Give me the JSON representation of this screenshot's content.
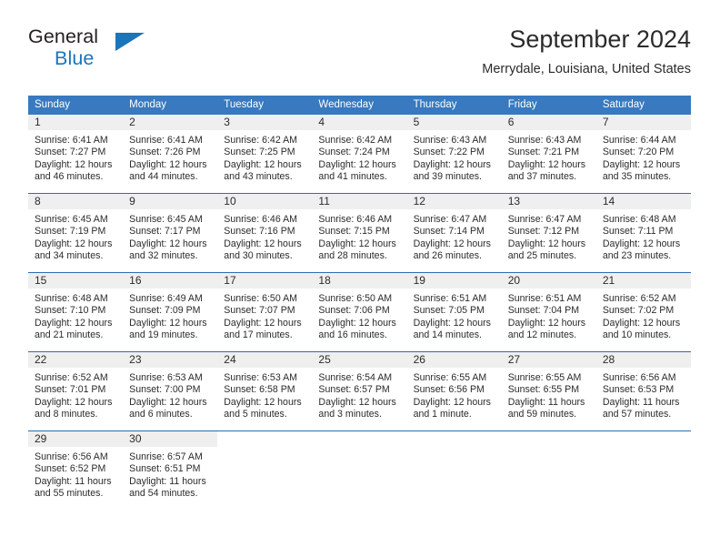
{
  "brand": {
    "name_part1": "General",
    "name_part2": "Blue",
    "accent_color": "#1b75bb",
    "logo_icon": "triangle-flag-icon"
  },
  "header": {
    "title": "September 2024",
    "subtitle": "Merrydale, Louisiana, United States"
  },
  "theme": {
    "header_bg": "#3879bf",
    "row_divider": "#2f6cae",
    "daynum_band": "#efefef"
  },
  "weekday_headers": [
    "Sunday",
    "Monday",
    "Tuesday",
    "Wednesday",
    "Thursday",
    "Friday",
    "Saturday"
  ],
  "weeks": [
    [
      {
        "day": "1",
        "sunrise": "Sunrise: 6:41 AM",
        "sunset": "Sunset: 7:27 PM",
        "daylight_line1": "Daylight: 12 hours",
        "daylight_line2": "and 46 minutes."
      },
      {
        "day": "2",
        "sunrise": "Sunrise: 6:41 AM",
        "sunset": "Sunset: 7:26 PM",
        "daylight_line1": "Daylight: 12 hours",
        "daylight_line2": "and 44 minutes."
      },
      {
        "day": "3",
        "sunrise": "Sunrise: 6:42 AM",
        "sunset": "Sunset: 7:25 PM",
        "daylight_line1": "Daylight: 12 hours",
        "daylight_line2": "and 43 minutes."
      },
      {
        "day": "4",
        "sunrise": "Sunrise: 6:42 AM",
        "sunset": "Sunset: 7:24 PM",
        "daylight_line1": "Daylight: 12 hours",
        "daylight_line2": "and 41 minutes."
      },
      {
        "day": "5",
        "sunrise": "Sunrise: 6:43 AM",
        "sunset": "Sunset: 7:22 PM",
        "daylight_line1": "Daylight: 12 hours",
        "daylight_line2": "and 39 minutes."
      },
      {
        "day": "6",
        "sunrise": "Sunrise: 6:43 AM",
        "sunset": "Sunset: 7:21 PM",
        "daylight_line1": "Daylight: 12 hours",
        "daylight_line2": "and 37 minutes."
      },
      {
        "day": "7",
        "sunrise": "Sunrise: 6:44 AM",
        "sunset": "Sunset: 7:20 PM",
        "daylight_line1": "Daylight: 12 hours",
        "daylight_line2": "and 35 minutes."
      }
    ],
    [
      {
        "day": "8",
        "sunrise": "Sunrise: 6:45 AM",
        "sunset": "Sunset: 7:19 PM",
        "daylight_line1": "Daylight: 12 hours",
        "daylight_line2": "and 34 minutes."
      },
      {
        "day": "9",
        "sunrise": "Sunrise: 6:45 AM",
        "sunset": "Sunset: 7:17 PM",
        "daylight_line1": "Daylight: 12 hours",
        "daylight_line2": "and 32 minutes."
      },
      {
        "day": "10",
        "sunrise": "Sunrise: 6:46 AM",
        "sunset": "Sunset: 7:16 PM",
        "daylight_line1": "Daylight: 12 hours",
        "daylight_line2": "and 30 minutes."
      },
      {
        "day": "11",
        "sunrise": "Sunrise: 6:46 AM",
        "sunset": "Sunset: 7:15 PM",
        "daylight_line1": "Daylight: 12 hours",
        "daylight_line2": "and 28 minutes."
      },
      {
        "day": "12",
        "sunrise": "Sunrise: 6:47 AM",
        "sunset": "Sunset: 7:14 PM",
        "daylight_line1": "Daylight: 12 hours",
        "daylight_line2": "and 26 minutes."
      },
      {
        "day": "13",
        "sunrise": "Sunrise: 6:47 AM",
        "sunset": "Sunset: 7:12 PM",
        "daylight_line1": "Daylight: 12 hours",
        "daylight_line2": "and 25 minutes."
      },
      {
        "day": "14",
        "sunrise": "Sunrise: 6:48 AM",
        "sunset": "Sunset: 7:11 PM",
        "daylight_line1": "Daylight: 12 hours",
        "daylight_line2": "and 23 minutes."
      }
    ],
    [
      {
        "day": "15",
        "sunrise": "Sunrise: 6:48 AM",
        "sunset": "Sunset: 7:10 PM",
        "daylight_line1": "Daylight: 12 hours",
        "daylight_line2": "and 21 minutes."
      },
      {
        "day": "16",
        "sunrise": "Sunrise: 6:49 AM",
        "sunset": "Sunset: 7:09 PM",
        "daylight_line1": "Daylight: 12 hours",
        "daylight_line2": "and 19 minutes."
      },
      {
        "day": "17",
        "sunrise": "Sunrise: 6:50 AM",
        "sunset": "Sunset: 7:07 PM",
        "daylight_line1": "Daylight: 12 hours",
        "daylight_line2": "and 17 minutes."
      },
      {
        "day": "18",
        "sunrise": "Sunrise: 6:50 AM",
        "sunset": "Sunset: 7:06 PM",
        "daylight_line1": "Daylight: 12 hours",
        "daylight_line2": "and 16 minutes."
      },
      {
        "day": "19",
        "sunrise": "Sunrise: 6:51 AM",
        "sunset": "Sunset: 7:05 PM",
        "daylight_line1": "Daylight: 12 hours",
        "daylight_line2": "and 14 minutes."
      },
      {
        "day": "20",
        "sunrise": "Sunrise: 6:51 AM",
        "sunset": "Sunset: 7:04 PM",
        "daylight_line1": "Daylight: 12 hours",
        "daylight_line2": "and 12 minutes."
      },
      {
        "day": "21",
        "sunrise": "Sunrise: 6:52 AM",
        "sunset": "Sunset: 7:02 PM",
        "daylight_line1": "Daylight: 12 hours",
        "daylight_line2": "and 10 minutes."
      }
    ],
    [
      {
        "day": "22",
        "sunrise": "Sunrise: 6:52 AM",
        "sunset": "Sunset: 7:01 PM",
        "daylight_line1": "Daylight: 12 hours",
        "daylight_line2": "and 8 minutes."
      },
      {
        "day": "23",
        "sunrise": "Sunrise: 6:53 AM",
        "sunset": "Sunset: 7:00 PM",
        "daylight_line1": "Daylight: 12 hours",
        "daylight_line2": "and 6 minutes."
      },
      {
        "day": "24",
        "sunrise": "Sunrise: 6:53 AM",
        "sunset": "Sunset: 6:58 PM",
        "daylight_line1": "Daylight: 12 hours",
        "daylight_line2": "and 5 minutes."
      },
      {
        "day": "25",
        "sunrise": "Sunrise: 6:54 AM",
        "sunset": "Sunset: 6:57 PM",
        "daylight_line1": "Daylight: 12 hours",
        "daylight_line2": "and 3 minutes."
      },
      {
        "day": "26",
        "sunrise": "Sunrise: 6:55 AM",
        "sunset": "Sunset: 6:56 PM",
        "daylight_line1": "Daylight: 12 hours",
        "daylight_line2": "and 1 minute."
      },
      {
        "day": "27",
        "sunrise": "Sunrise: 6:55 AM",
        "sunset": "Sunset: 6:55 PM",
        "daylight_line1": "Daylight: 11 hours",
        "daylight_line2": "and 59 minutes."
      },
      {
        "day": "28",
        "sunrise": "Sunrise: 6:56 AM",
        "sunset": "Sunset: 6:53 PM",
        "daylight_line1": "Daylight: 11 hours",
        "daylight_line2": "and 57 minutes."
      }
    ],
    [
      {
        "day": "29",
        "sunrise": "Sunrise: 6:56 AM",
        "sunset": "Sunset: 6:52 PM",
        "daylight_line1": "Daylight: 11 hours",
        "daylight_line2": "and 55 minutes."
      },
      {
        "day": "30",
        "sunrise": "Sunrise: 6:57 AM",
        "sunset": "Sunset: 6:51 PM",
        "daylight_line1": "Daylight: 11 hours",
        "daylight_line2": "and 54 minutes."
      },
      {
        "day": "",
        "sunrise": "",
        "sunset": "",
        "daylight_line1": "",
        "daylight_line2": ""
      },
      {
        "day": "",
        "sunrise": "",
        "sunset": "",
        "daylight_line1": "",
        "daylight_line2": ""
      },
      {
        "day": "",
        "sunrise": "",
        "sunset": "",
        "daylight_line1": "",
        "daylight_line2": ""
      },
      {
        "day": "",
        "sunrise": "",
        "sunset": "",
        "daylight_line1": "",
        "daylight_line2": ""
      },
      {
        "day": "",
        "sunrise": "",
        "sunset": "",
        "daylight_line1": "",
        "daylight_line2": ""
      }
    ]
  ]
}
